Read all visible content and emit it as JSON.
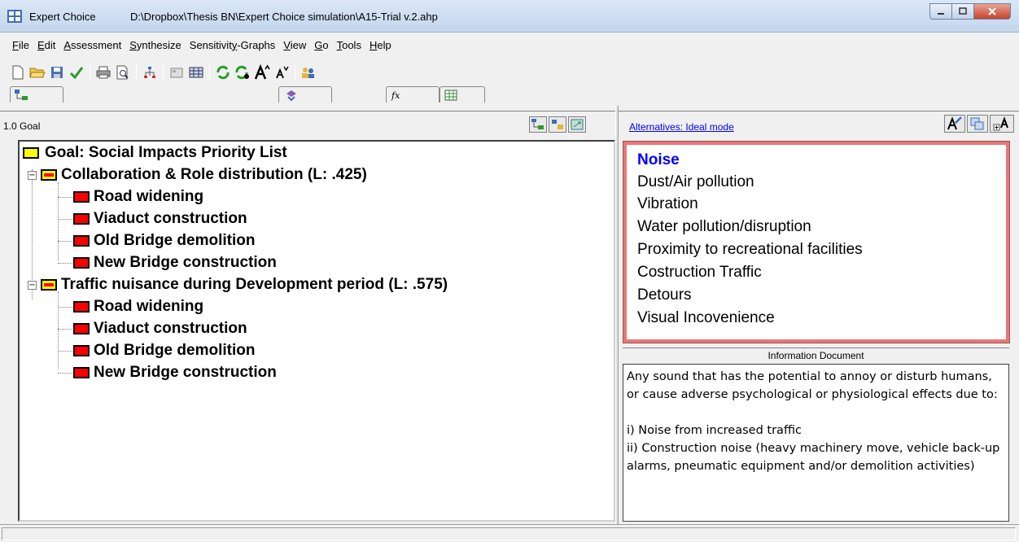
{
  "window": {
    "app_name": "Expert Choice",
    "file_path": "D:\\Dropbox\\Thesis BN\\Expert Choice simulation\\A15-Trial v.2.ahp"
  },
  "menu": [
    {
      "label": "File",
      "key": "F",
      "rest": "ile"
    },
    {
      "label": "Edit",
      "key": "E",
      "rest": "dit"
    },
    {
      "label": "Assessment",
      "key": "A",
      "rest": "ssessment"
    },
    {
      "label": "Synthesize",
      "key": "S",
      "rest": "ynthesize"
    },
    {
      "label": "Sensitivity-Graphs",
      "pre": "Sensitivit",
      "key": "y",
      "rest": "-Graphs"
    },
    {
      "label": "View",
      "key": "V",
      "rest": "iew"
    },
    {
      "label": "Go",
      "key": "G",
      "rest": "o"
    },
    {
      "label": "Tools",
      "key": "T",
      "rest": "ools"
    },
    {
      "label": "Help",
      "key": "H",
      "rest": "elp"
    }
  ],
  "left_header": {
    "title": "1.0 Goal"
  },
  "tree": {
    "goal": "Goal: Social Impacts Priority List",
    "objectives": [
      {
        "label": "Collaboration & Role distribution (L: .425)",
        "children": [
          "Road widening",
          "Viaduct construction",
          "Old Bridge demolition",
          "New Bridge construction"
        ]
      },
      {
        "label": "Traffic nuisance during Development period (L: .575)",
        "children": [
          "Road widening",
          "Viaduct construction",
          "Old Bridge demolition",
          "New Bridge construction"
        ]
      }
    ]
  },
  "right_header": {
    "link": "Alternatives: Ideal mode"
  },
  "alternatives": [
    "Noise",
    "Dust/Air pollution",
    "Vibration",
    "Water pollution/disruption",
    "Proximity to recreational facilities",
    "Costruction Traffic",
    "Detours",
    "Visual Incovenience"
  ],
  "info": {
    "title": "Information Document",
    "text": "Any sound that has the potential to annoy or disturb humans, or cause adverse psychological or physiological effects due to:\n\ni) Noise from increased traffic\nii) Construction noise (heavy machinery move, vehicle back-up alarms, pneumatic equipment and/or demolition activities)"
  },
  "colors": {
    "goal_node": "#ffff00",
    "leaf_node": "#ff0000",
    "selected_alt": "#0000ff",
    "alt_border": "#e87878"
  }
}
